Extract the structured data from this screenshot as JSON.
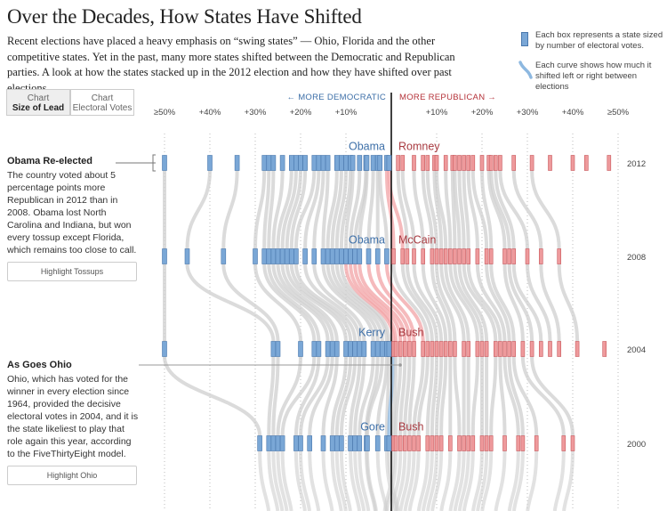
{
  "header": {
    "title": "Over the Decades, How States Have Shifted",
    "intro": "Recent elections have placed a heavy emphasis on “swing states” — Ohio, Florida and the other competitive states. Yet in the past, many more states shifted between the Democratic and Republican parties. A look at how the states stacked up in the 2012 election and how they have shifted over past elections."
  },
  "legend": {
    "box_text": "Each box represents a state sized by number of electoral votes.",
    "curve_text": "Each curve shows how much it shifted left or right between elections"
  },
  "toggle": {
    "size_of_lead": {
      "line1": "Chart",
      "line2": "Size of Lead"
    },
    "electoral_votes": {
      "line1": "Chart",
      "line2": "Electoral Votes"
    }
  },
  "axis": {
    "more_democratic": "← MORE DEMOCRATIC",
    "more_republican": "MORE REPUBLICAN →",
    "dem_ticks": [
      {
        "label": "≥50%",
        "value": 50
      },
      {
        "label": "+40%",
        "value": 40
      },
      {
        "label": "+30%",
        "value": 30
      },
      {
        "label": "+20%",
        "value": 20
      },
      {
        "label": "+10%",
        "value": 10
      }
    ],
    "rep_ticks": [
      {
        "label": "+10%",
        "value": 10
      },
      {
        "label": "+20%",
        "value": 20
      },
      {
        "label": "+30%",
        "value": 30
      },
      {
        "label": "+40%",
        "value": 40
      },
      {
        "label": "≥50%",
        "value": 50
      }
    ]
  },
  "sidebar": {
    "obama": {
      "heading": "Obama Re-elected",
      "text": "The country voted about 5 percentage points more Republican in 2012 than in 2008. Obama lost North Carolina and Indiana, but won every tossup except Florida, which remains too close to call.",
      "button": "Highlight Tossups"
    },
    "ohio": {
      "heading": "As Goes Ohio",
      "text": "Ohio, which has voted for the winner in every election since 1964, provided the decisive electoral votes in 2004, and it is the state likeliest to play that role again this year, according to the FiveThirtyEight model.",
      "button": "Highlight Ohio"
    }
  },
  "colors": {
    "dem_box": "#7aa7d6",
    "dem_stroke": "#4a78ad",
    "rep_box": "#ee9a9c",
    "rep_stroke": "#c9585c",
    "dem_text": "#3d6fa8",
    "rep_text": "#a83a40",
    "curve_gray": "#cfcfcf",
    "curve_blue": "#8db8e0",
    "curve_red": "#f1a3a6"
  },
  "chart_data": {
    "type": "scatter",
    "xlim": [
      -50,
      50
    ],
    "rows": [
      {
        "year": "2012",
        "dem": "Obama",
        "rep": "Romney",
        "dem_margins": [
          50,
          40,
          34,
          28,
          27,
          26,
          24,
          22,
          21,
          20,
          19,
          17,
          16,
          15,
          14,
          12,
          11,
          10,
          9,
          8.5,
          7,
          5.6,
          5.4,
          4,
          3,
          2.5,
          1,
          0.5
        ],
        "rep_margins": [
          1.5,
          2.5,
          5,
          7,
          8,
          9.5,
          10,
          12,
          13.5,
          14,
          15,
          16,
          17,
          18,
          20,
          21.5,
          22,
          23,
          24,
          27,
          31,
          35,
          40,
          43,
          48
        ]
      },
      {
        "year": "2008",
        "dem": "Obama",
        "rep": "McCain",
        "dem_margins": [
          50,
          45,
          37,
          30,
          28,
          27,
          26,
          25,
          24,
          23,
          22,
          21,
          19,
          17,
          15,
          14,
          13,
          12,
          11,
          10,
          9,
          8,
          7,
          5,
          3,
          1
        ],
        "rep_margins": [
          0.5,
          2.5,
          3.5,
          5,
          7,
          9,
          10,
          11,
          12,
          13,
          14,
          15,
          16,
          17,
          19,
          21,
          22,
          25,
          26,
          27,
          30,
          33,
          37
        ]
      },
      {
        "year": "2004",
        "dem": "Kerry",
        "rep": "Bush",
        "dem_margins": [
          50,
          26,
          25,
          20,
          17,
          16,
          14,
          13,
          12,
          10,
          9,
          8,
          7,
          6,
          4,
          3,
          2,
          1,
          0.5
        ],
        "rep_margins": [
          0.5,
          1,
          2,
          3,
          4,
          5,
          7,
          8,
          9,
          10,
          11,
          12,
          13,
          14,
          16,
          17,
          19,
          20,
          21,
          23,
          24,
          25,
          26,
          27,
          29,
          31,
          33,
          35,
          37,
          41,
          47
        ]
      },
      {
        "year": "2000",
        "dem": "Gore",
        "rep": "Bush",
        "dem_margins": [
          29,
          27,
          26,
          25,
          24,
          21,
          20,
          18,
          15,
          13,
          12,
          11,
          9,
          8,
          7,
          5.5,
          5.3,
          3,
          1,
          0.5
        ],
        "rep_margins": [
          0.5,
          1,
          2,
          3,
          4,
          5,
          6,
          8,
          9,
          10,
          11,
          13,
          15,
          16,
          17,
          18,
          20,
          21,
          22,
          25,
          28,
          29,
          32,
          38,
          40
        ]
      }
    ]
  }
}
